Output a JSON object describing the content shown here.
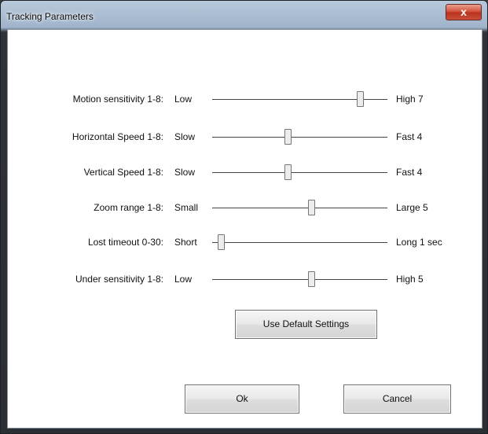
{
  "window": {
    "title": "Tracking Parameters",
    "close_label": "x"
  },
  "sliders": [
    {
      "label": "Motion sensitivity 1-8:",
      "low": "Low",
      "high": "High 7",
      "fraction": 0.857
    },
    {
      "label": "Horizontal Speed 1-8:",
      "low": "Slow",
      "high": "Fast 4",
      "fraction": 0.429
    },
    {
      "label": "Vertical Speed 1-8:",
      "low": "Slow",
      "high": "Fast 4",
      "fraction": 0.429
    },
    {
      "label": "Zoom range 1-8:",
      "low": "Small",
      "high": "Large 5",
      "fraction": 0.571
    },
    {
      "label": "Lost timeout 0-30:",
      "low": "Short",
      "high": "Long 1 sec",
      "fraction": 0.033
    },
    {
      "label": "Under sensitivity 1-8:",
      "low": "Low",
      "high": "High 5",
      "fraction": 0.571
    }
  ],
  "buttons": {
    "defaults": "Use Default Settings",
    "ok": "Ok",
    "cancel": "Cancel"
  }
}
